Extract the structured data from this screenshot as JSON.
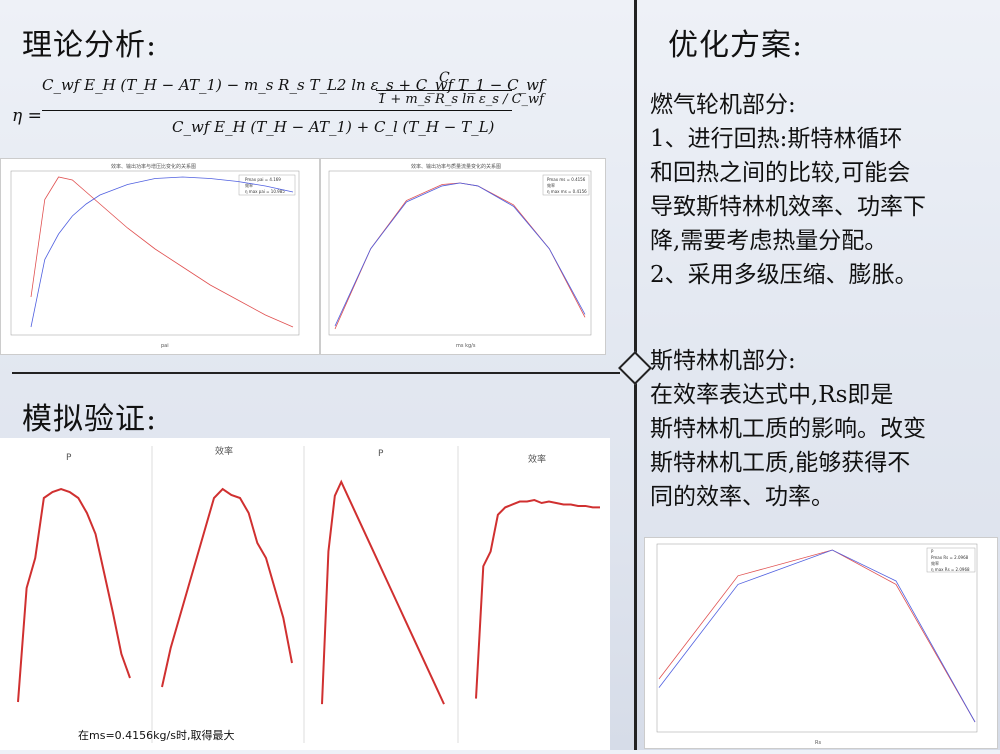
{
  "headings": {
    "theory": "理论分析:",
    "optimize": "优化方案:",
    "verify": "模拟验证:"
  },
  "formula": {
    "eta": "η =",
    "numerator": "C_wf E_H (T_H − AT_1) − m_s R_s T_L2 ln ε_s + C_wf T_1 − C_wf",
    "inner_numerator": "C",
    "inner_denominator": "1 + m_s R_s ln ε_s / C_wf",
    "denominator": "C_wf E_H (T_H − AT_1) + C_l (T_H − T_L)"
  },
  "right_text": {
    "section1_title": "燃气轮机部分:",
    "section1_lines": [
      "1、进行回热:斯特林循环",
      "和回热之间的比较,可能会",
      "导致斯特林机效率、功率下",
      "降,需要考虑热量分配。",
      "2、采用多级压缩、膨胀。"
    ],
    "section2_title": "斯特林机部分:",
    "section2_lines": [
      "在效率表达式中,Rs即是",
      "斯特林机工质的影响。改变",
      "斯特林机工质,能够获得不",
      "同的效率、功率。"
    ]
  },
  "top_charts": {
    "left_title": "效率、输出功率与增压比变化的关系图",
    "left_xlabel": "pai",
    "left_legend": [
      "Pmax pai = 4.169",
      "效率",
      "η max pai = 10.985"
    ],
    "right_title": "效率、输出功率与质量流量变化的关系图",
    "right_xlabel": "ms kg/s",
    "right_legend": [
      "Pmax ms = 0.4156",
      "效率",
      "η max ms = 0.4156"
    ]
  },
  "bottom_charts": [
    {
      "title": "P"
    },
    {
      "title": "效率"
    },
    {
      "title": "P"
    },
    {
      "title": "效率"
    }
  ],
  "bottom_caption": "在ms=0.4156kg/s时,取得最大",
  "rs_chart": {
    "xlabel": "Rs",
    "legend": [
      "P",
      "Pmax Rs = 2.0968",
      "效率",
      "η max Rs = 2.0968"
    ]
  },
  "chart_data": [
    {
      "type": "line",
      "name": "top-left",
      "x": [
        1,
        2,
        3,
        4,
        5,
        6,
        8,
        10,
        12,
        14,
        16,
        18,
        20
      ],
      "series": [
        {
          "values": [
            0.2,
            0.85,
            1.0,
            0.98,
            0.9,
            0.82,
            0.66,
            0.52,
            0.4,
            0.28,
            0.18,
            0.08,
            0.0
          ]
        },
        {
          "values": [
            0.0,
            0.45,
            0.62,
            0.74,
            0.82,
            0.88,
            0.95,
            0.99,
            1.0,
            0.99,
            0.97,
            0.94,
            0.9
          ]
        }
      ]
    },
    {
      "type": "line",
      "name": "top-right",
      "x": [
        0.1,
        0.2,
        0.3,
        0.4,
        0.45,
        0.5,
        0.6,
        0.7,
        0.8
      ],
      "series": [
        {
          "values": [
            0.0,
            0.55,
            0.88,
            0.99,
            1.0,
            0.98,
            0.85,
            0.55,
            0.08
          ]
        },
        {
          "values": [
            0.02,
            0.55,
            0.87,
            0.98,
            1.0,
            0.98,
            0.84,
            0.55,
            0.1
          ]
        }
      ]
    },
    {
      "type": "line",
      "name": "bottom-1-P",
      "categories": [
        "0.1",
        "0.15",
        "0.2",
        "0.25",
        "0.3",
        "0.35",
        "0.4",
        "0.45",
        "0.5",
        "0.55",
        "0.6",
        "0.65",
        "0.7",
        "0.75",
        "0.8",
        "0.85",
        "0.9",
        "0.95"
      ],
      "ylim": [
        320,
        400
      ],
      "values": [
        322,
        360,
        370,
        390,
        392,
        393,
        392,
        390,
        385,
        378,
        365,
        352,
        338,
        330
      ]
    },
    {
      "type": "line",
      "name": "bottom-2-eff",
      "categories": [
        "0.1",
        "0.15",
        "0.2",
        "0.25",
        "0.3",
        "0.35",
        "0.4",
        "0.45",
        "0.5",
        "0.55",
        "0.6",
        "0.65",
        "0.7",
        "0.75",
        "0.8",
        "0.85",
        "0.9",
        "0.95"
      ],
      "ylim": [
        0.32,
        0.4
      ],
      "values": [
        0.327,
        0.34,
        0.35,
        0.36,
        0.37,
        0.38,
        0.39,
        0.393,
        0.391,
        0.39,
        0.385,
        0.375,
        0.37,
        0.36,
        0.35,
        0.335
      ]
    },
    {
      "type": "line",
      "name": "bottom-3-P",
      "categories": [
        "1",
        "2",
        "3",
        "4",
        "5",
        "6",
        "7",
        "8",
        "9",
        "10",
        "11",
        "12",
        "13",
        "14",
        "15",
        "16",
        "17",
        "18",
        "19",
        "20"
      ],
      "ylim": [
        310,
        400
      ],
      "values": [
        315,
        370,
        390,
        395,
        390,
        385,
        380,
        375,
        370,
        365,
        360,
        355,
        350,
        345,
        340,
        335,
        330,
        325,
        320,
        315
      ]
    },
    {
      "type": "line",
      "name": "bottom-4-eff",
      "categories": [
        "1",
        "2",
        "3",
        "4",
        "5",
        "6",
        "7",
        "8",
        "9",
        "10",
        "11",
        "12",
        "13",
        "14",
        "15",
        "16",
        "17",
        "18",
        "19",
        "20"
      ],
      "ylim": [
        0.25,
        0.42
      ],
      "values": [
        0.27,
        0.36,
        0.37,
        0.395,
        0.4,
        0.402,
        0.404,
        0.404,
        0.405,
        0.403,
        0.404,
        0.403,
        0.402,
        0.402,
        0.401,
        0.401,
        0.4,
        0.4
      ]
    },
    {
      "type": "line",
      "name": "rs-chart",
      "x": [
        1.0,
        1.5,
        2.0968,
        2.5,
        3.0
      ],
      "series": [
        {
          "values": [
            0.25,
            0.85,
            1.0,
            0.8,
            0.0
          ]
        },
        {
          "values": [
            0.2,
            0.8,
            1.0,
            0.82,
            0.0
          ]
        }
      ]
    }
  ]
}
